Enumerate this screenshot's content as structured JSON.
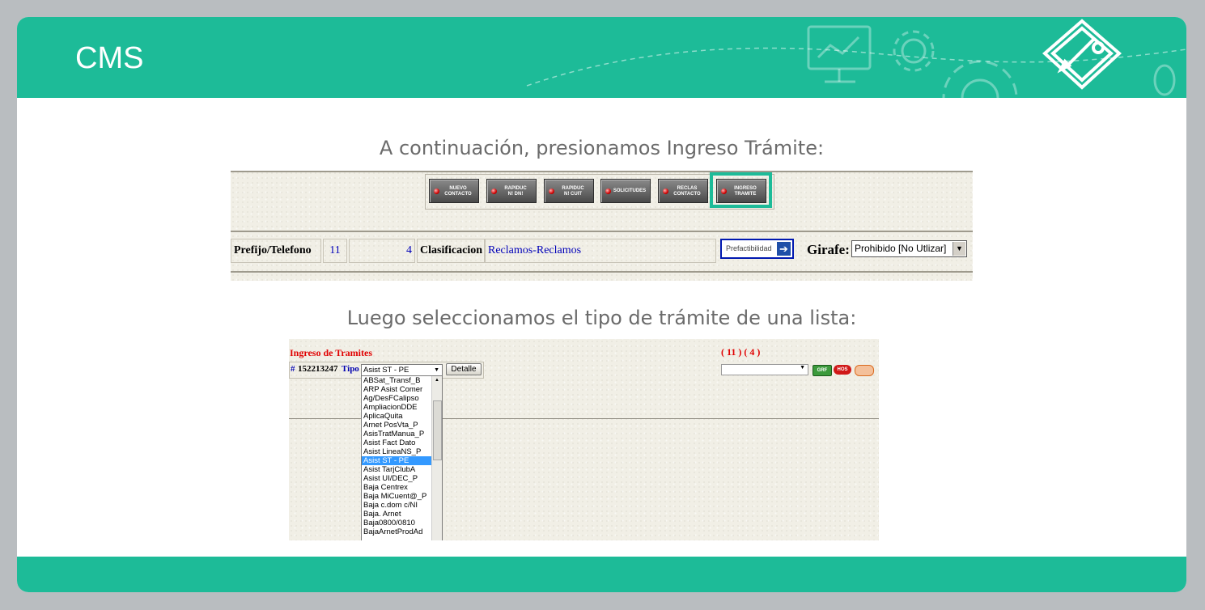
{
  "header": {
    "title": "CMS"
  },
  "captions": {
    "step1": "A continuación, presionamos Ingreso Trámite:",
    "step2": "Luego seleccionamos el tipo de trámite de una lista:"
  },
  "toolbar": {
    "buttons": [
      {
        "line1": "NUEVO",
        "line2": "CONTACTO"
      },
      {
        "line1": "RAPIDUC",
        "line2": "N! DN!"
      },
      {
        "line1": "RAPIDUC",
        "line2": "N! CUIT"
      },
      {
        "line1": "SOLICITUDES",
        "line2": ""
      },
      {
        "line1": "RECLAS",
        "line2": "CONTACTO"
      },
      {
        "line1": "INGRESO",
        "line2": "TRAMITE"
      }
    ]
  },
  "contact_row": {
    "prefijo_label": "Prefijo/Telefono",
    "prefijo_value": "11",
    "telefono_value": "4",
    "clasificacion_label": "Clasificacion",
    "clasificacion_value": "Reclamos-Reclamos",
    "prefactibilidad_button": "Prefactibilidad",
    "girafe_label": "Girafe:",
    "girafe_select": "Prohibido [No Utlizar]"
  },
  "tramites": {
    "title": "Ingreso de Tramites",
    "codes": "( 11 ) ( 4 )",
    "hash": "#",
    "number": "152213247",
    "tipo_label": "Tipo",
    "tipo_selected": "Asist ST - PE",
    "detalle_button": "Detalle",
    "icon_grf": "GRF",
    "icon_hos": "HOS",
    "options": [
      "ABSat_Transf_B",
      "ARP Asist Comer",
      "Ag/DesFCalipso",
      "AmpliacionDDE",
      "AplicaQuita",
      "Arnet PosVta_P",
      "AsisTratManua_P",
      "Asist Fact Dato",
      "Asist LineaNS_P",
      "Asist ST - PE",
      "Asist TarjClubA",
      "Asist UI/DEC_P",
      "Baja Centrex",
      "Baja MiCuent@_P",
      "Baja c.dom c/NI",
      "Baja. Arnet",
      "Baja0800/0810",
      "BajaArnetProdAd"
    ],
    "selected_index": 9
  }
}
